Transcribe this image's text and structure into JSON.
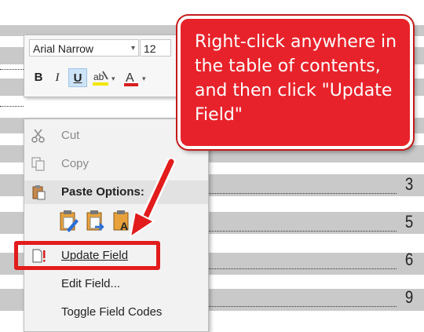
{
  "mini_toolbar": {
    "font_name": "Arial Narrow",
    "font_size": "12",
    "bold_label": "B",
    "italic_label": "I",
    "underline_label": "U",
    "font_color_label": "A"
  },
  "context_menu": {
    "items": [
      {
        "label": "Cut",
        "icon": "scissors-icon",
        "enabled": false
      },
      {
        "label": "Copy",
        "icon": "copy-icon",
        "enabled": false
      },
      {
        "label": "Paste Options:",
        "icon": "clipboard-icon",
        "header": true
      },
      {
        "label": "Update Field",
        "icon": "update-field-icon",
        "enabled": true
      },
      {
        "label": "Edit Field...",
        "icon": "",
        "enabled": true
      },
      {
        "label": "Toggle Field Codes",
        "icon": "",
        "enabled": true
      }
    ],
    "paste_icons": [
      "paste-keep-formatting-icon",
      "paste-merge-formatting-icon",
      "paste-text-only-icon"
    ]
  },
  "toc": {
    "page_numbers": [
      "3",
      "5",
      "6",
      "9"
    ]
  },
  "callout": {
    "text": "Right-click anywhere in the table of contents, and then click \"Update Field\"",
    "color": "#e8222a"
  }
}
